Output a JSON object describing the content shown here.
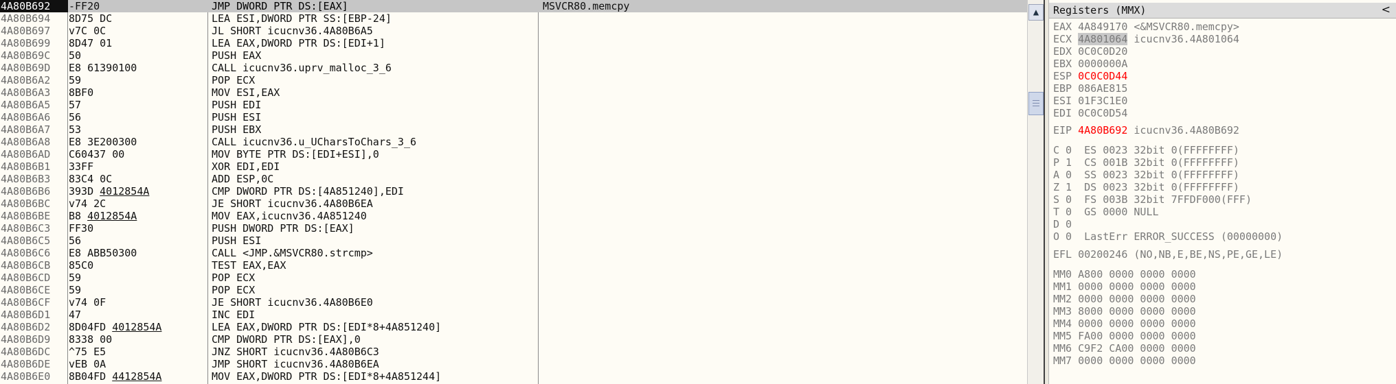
{
  "disassembly": {
    "rows": [
      {
        "addr": "4A80B692",
        "jmp": "",
        "hex": "-FF20",
        "ins": "JMP DWORD PTR DS:[EAX]",
        "com": "MSVCR80.memcpy"
      },
      {
        "addr": "4A80B694",
        "jmp": "",
        "hex": "8D75 DC",
        "ins": "LEA ESI,DWORD PTR SS:[EBP-24]",
        "com": ""
      },
      {
        "addr": "4A80B697",
        "jmp": "v",
        "hex": "7C 0C",
        "ins": "JL SHORT icucnv36.4A80B6A5",
        "com": ""
      },
      {
        "addr": "4A80B699",
        "jmp": "",
        "hex": "8D47 01",
        "ins": "LEA EAX,DWORD PTR DS:[EDI+1]",
        "com": ""
      },
      {
        "addr": "4A80B69C",
        "jmp": "",
        "hex": "50",
        "ins": "PUSH EAX",
        "com": ""
      },
      {
        "addr": "4A80B69D",
        "jmp": "",
        "hex": "E8 61390100",
        "ins": "CALL icucnv36.uprv_malloc_3_6",
        "com": ""
      },
      {
        "addr": "4A80B6A2",
        "jmp": "",
        "hex": "59",
        "ins": "POP ECX",
        "com": ""
      },
      {
        "addr": "4A80B6A3",
        "jmp": "",
        "hex": "8BF0",
        "ins": "MOV ESI,EAX",
        "com": ""
      },
      {
        "addr": "4A80B6A5",
        "jmp": "",
        "hex": "57",
        "ins": "PUSH EDI",
        "com": ""
      },
      {
        "addr": "4A80B6A6",
        "jmp": "",
        "hex": "56",
        "ins": "PUSH ESI",
        "com": ""
      },
      {
        "addr": "4A80B6A7",
        "jmp": "",
        "hex": "53",
        "ins": "PUSH EBX",
        "com": ""
      },
      {
        "addr": "4A80B6A8",
        "jmp": "",
        "hex": "E8 3E200300",
        "ins": "CALL icucnv36.u_UCharsToChars_3_6",
        "com": ""
      },
      {
        "addr": "4A80B6AD",
        "jmp": "",
        "hex": "C60437 00",
        "ins": "MOV BYTE PTR DS:[EDI+ESI],0",
        "com": ""
      },
      {
        "addr": "4A80B6B1",
        "jmp": "",
        "hex": "33FF",
        "ins": "XOR EDI,EDI",
        "com": ""
      },
      {
        "addr": "4A80B6B3",
        "jmp": "",
        "hex": "83C4 0C",
        "ins": "ADD ESP,0C",
        "com": ""
      },
      {
        "addr": "4A80B6B6",
        "jmp": "",
        "hex": "393D 4012854A",
        "ins": "CMP DWORD PTR DS:[4A851240],EDI",
        "com": "",
        "u": "4012854A"
      },
      {
        "addr": "4A80B6BC",
        "jmp": "v",
        "hex": "74 2C",
        "ins": "JE SHORT icucnv36.4A80B6EA",
        "com": ""
      },
      {
        "addr": "4A80B6BE",
        "jmp": "",
        "hex": "B8 4012854A",
        "ins": "MOV EAX,icucnv36.4A851240",
        "com": "",
        "u": "4012854A"
      },
      {
        "addr": "4A80B6C3",
        "jmp": "",
        "hex": "FF30",
        "ins": "PUSH DWORD PTR DS:[EAX]",
        "com": ""
      },
      {
        "addr": "4A80B6C5",
        "jmp": "",
        "hex": "56",
        "ins": "PUSH ESI",
        "com": ""
      },
      {
        "addr": "4A80B6C6",
        "jmp": "",
        "hex": "E8 ABB50300",
        "ins": "CALL <JMP.&MSVCR80.strcmp>",
        "com": ""
      },
      {
        "addr": "4A80B6CB",
        "jmp": "",
        "hex": "85C0",
        "ins": "TEST EAX,EAX",
        "com": ""
      },
      {
        "addr": "4A80B6CD",
        "jmp": "",
        "hex": "59",
        "ins": "POP ECX",
        "com": ""
      },
      {
        "addr": "4A80B6CE",
        "jmp": "",
        "hex": "59",
        "ins": "POP ECX",
        "com": ""
      },
      {
        "addr": "4A80B6CF",
        "jmp": "v",
        "hex": "74 0F",
        "ins": "JE SHORT icucnv36.4A80B6E0",
        "com": ""
      },
      {
        "addr": "4A80B6D1",
        "jmp": "",
        "hex": "47",
        "ins": "INC EDI",
        "com": ""
      },
      {
        "addr": "4A80B6D2",
        "jmp": "",
        "hex": "8D04FD 4012854A",
        "ins": "LEA EAX,DWORD PTR DS:[EDI*8+4A851240]",
        "com": "",
        "u": "4012854A"
      },
      {
        "addr": "4A80B6D9",
        "jmp": "",
        "hex": "8338 00",
        "ins": "CMP DWORD PTR DS:[EAX],0",
        "com": ""
      },
      {
        "addr": "4A80B6DC",
        "jmp": "^",
        "hex": "75 E5",
        "ins": "JNZ SHORT icucnv36.4A80B6C3",
        "com": ""
      },
      {
        "addr": "4A80B6DE",
        "jmp": "v",
        "hex": "EB 0A",
        "ins": "JMP SHORT icucnv36.4A80B6EA",
        "com": ""
      },
      {
        "addr": "4A80B6E0",
        "jmp": "",
        "hex": "8B04FD 4412854A",
        "ins": "MOV EAX,DWORD PTR DS:[EDI*8+4A851244]",
        "com": "",
        "u": "4412854A"
      }
    ]
  },
  "registers": {
    "title": "Registers (MMX)",
    "collapse_glyph": "<",
    "lines": {
      "eax": "EAX 4A849170 <&MSVCR80.memcpy>",
      "ecx_name": "ECX ",
      "ecx_val": "4A801064",
      "ecx_tail": " icucnv36.4A801064",
      "edx": "EDX 0C0C0D20",
      "ebx": "EBX 0000000A",
      "esp_name": "ESP ",
      "esp_val": "0C0C0D44",
      "ebp": "EBP 086AE815",
      "esi": "ESI 01F3C1E0",
      "edi": "EDI 0C0C0D54",
      "eip_name": "EIP ",
      "eip_val": "4A80B692",
      "eip_tail": " icucnv36.4A80B692",
      "f_c": "C 0  ES 0023 32bit 0(FFFFFFFF)",
      "f_p": "P 1  CS 001B 32bit 0(FFFFFFFF)",
      "f_a": "A 0  SS 0023 32bit 0(FFFFFFFF)",
      "f_z": "Z 1  DS 0023 32bit 0(FFFFFFFF)",
      "f_s": "S 0  FS 003B 32bit 7FFDF000(FFF)",
      "f_t": "T 0  GS 0000 NULL",
      "f_d": "D 0",
      "f_o": "O 0  LastErr ERROR_SUCCESS (00000000)",
      "efl": "EFL 00200246 (NO,NB,E,BE,NS,PE,GE,LE)",
      "mm0": "MM0 A800 0000 0000 0000",
      "mm1": "MM1 0000 0000 0000 0000",
      "mm2": "MM2 0000 0000 0000 0000",
      "mm3": "MM3 8000 0000 0000 0000",
      "mm4": "MM4 0000 0000 0000 0000",
      "mm5": "MM5 FA00 0000 0000 0000",
      "mm6": "MM6 C9F2 CA00 0000 0000",
      "mm7": "MM7 0000 0000 0000 0000"
    }
  },
  "scrollbar": {
    "up_glyph": "▲"
  },
  "colors": {
    "highlight_red": "#ff0000",
    "selection_bg": "#101010"
  }
}
